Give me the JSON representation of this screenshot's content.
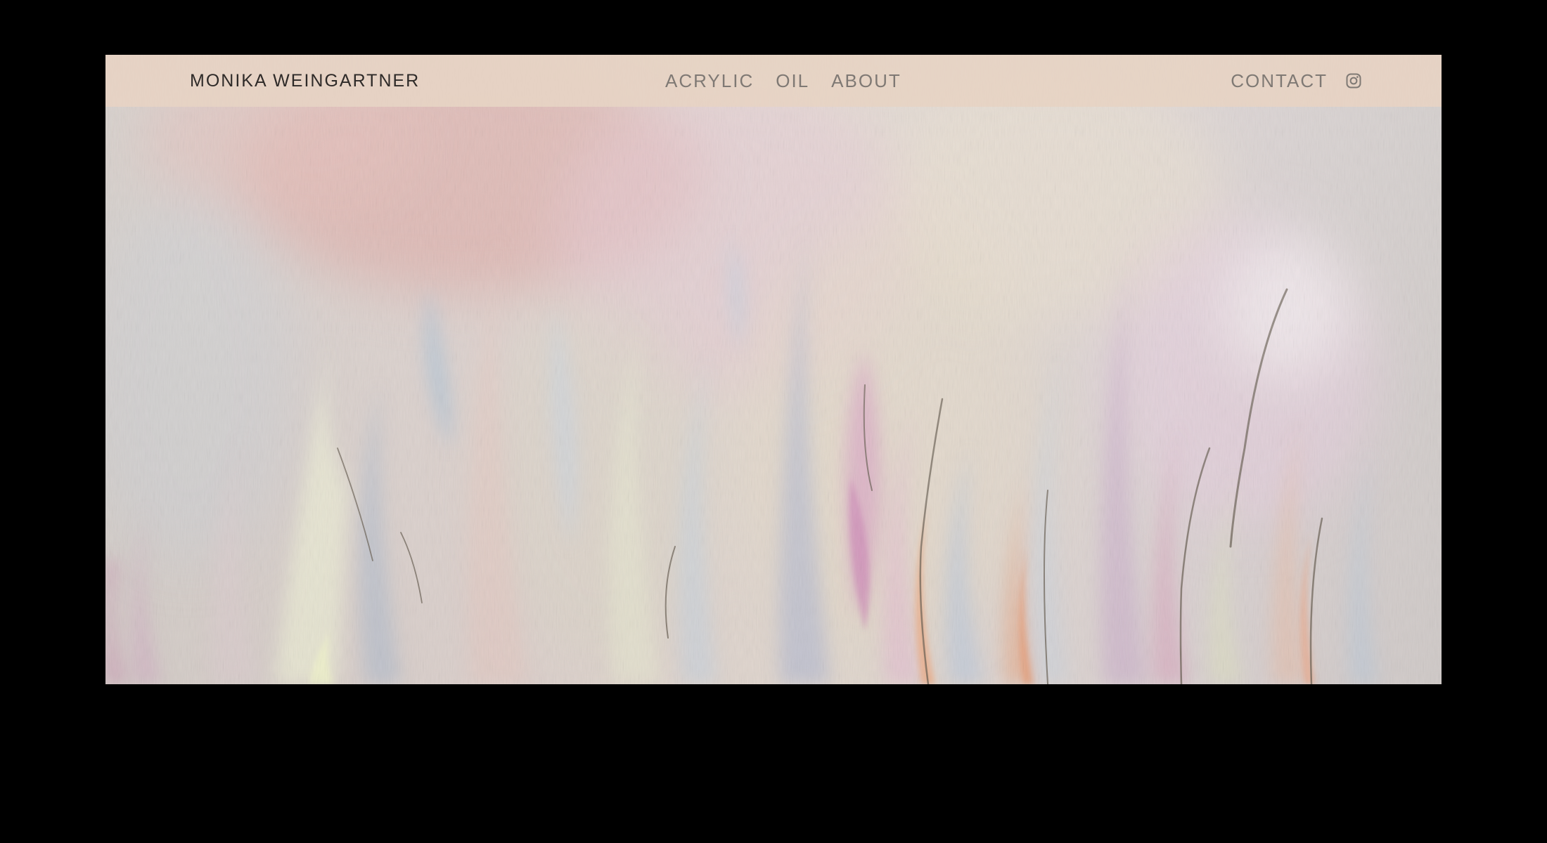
{
  "site": {
    "title": "MONIKA WEINGARTNER"
  },
  "nav": {
    "items": [
      {
        "label": "ACRYLIC"
      },
      {
        "label": "OIL"
      },
      {
        "label": "ABOUT"
      }
    ]
  },
  "header_right": {
    "contact_label": "CONTACT",
    "social_icon": "instagram-icon"
  },
  "hero": {
    "image": "abstract-pastel-painting"
  },
  "colors": {
    "page_background": "#000000",
    "header_background": "#e6d3c4",
    "title_text": "#2e2a28",
    "nav_text": "#7f7974",
    "painting_base": "#cfc8c4"
  }
}
